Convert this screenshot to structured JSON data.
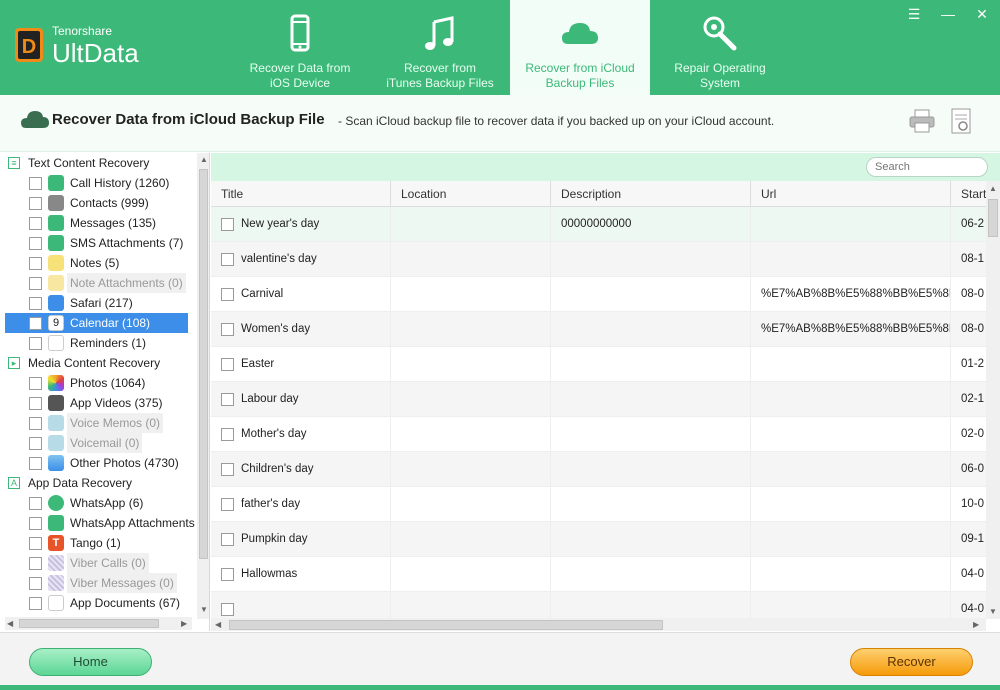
{
  "app": {
    "brand_small": "Tenorshare",
    "brand_big": "UltData",
    "accent_color": "#3cb878"
  },
  "tabs": [
    {
      "label_line1": "Recover Data from",
      "label_line2": "iOS Device",
      "icon": "phone-icon",
      "active": false
    },
    {
      "label_line1": "Recover from",
      "label_line2": "iTunes Backup Files",
      "icon": "music-note-icon",
      "active": false
    },
    {
      "label_line1": "Recover from iCloud",
      "label_line2": "Backup Files",
      "icon": "cloud-icon",
      "active": true
    },
    {
      "label_line1": "Repair Operating",
      "label_line2": "System",
      "icon": "wrench-icon",
      "active": false
    }
  ],
  "subheader": {
    "title": "Recover Data from iCloud Backup File",
    "description": "- Scan iCloud backup file to recover data if you backed up on your iCloud account."
  },
  "sidebar": {
    "categories": [
      {
        "label": "Text Content Recovery",
        "items": [
          {
            "label": "Call History (1260)",
            "icon": "phone-icon",
            "color": "#3cb878"
          },
          {
            "label": "Contacts (999)",
            "icon": "contacts-icon",
            "color": "#888888"
          },
          {
            "label": "Messages (135)",
            "icon": "message-icon",
            "color": "#3cb878"
          },
          {
            "label": "SMS Attachments (7)",
            "icon": "paperclip-icon",
            "color": "#3cb878"
          },
          {
            "label": "Notes (5)",
            "icon": "notes-icon",
            "color": "#f7e27a"
          },
          {
            "label": "Note Attachments (0)",
            "icon": "note-attachment-icon",
            "color": "#f7e7a0",
            "disabled": true
          },
          {
            "label": "Safari (217)",
            "icon": "safari-icon",
            "color": "#3c8ee8"
          },
          {
            "label": "Calendar (108)",
            "icon": "calendar-icon",
            "color": "#ffffff",
            "selected": true
          },
          {
            "label": "Reminders (1)",
            "icon": "reminders-icon",
            "color": "#ffffff"
          }
        ]
      },
      {
        "label": "Media Content Recovery",
        "items": [
          {
            "label": "Photos (1064)",
            "icon": "photos-icon",
            "color": "#f0a030"
          },
          {
            "label": "App Videos (375)",
            "icon": "video-icon",
            "color": "#555555"
          },
          {
            "label": "Voice Memos (0)",
            "icon": "microphone-icon",
            "color": "#b8dbe8",
            "disabled": true
          },
          {
            "label": "Voicemail (0)",
            "icon": "voicemail-icon",
            "color": "#b8dbe8",
            "disabled": true
          },
          {
            "label": "Other Photos (4730)",
            "icon": "landscape-icon",
            "color": "#4aa0e0"
          }
        ]
      },
      {
        "label": "App Data Recovery",
        "items": [
          {
            "label": "WhatsApp (6)",
            "icon": "whatsapp-icon",
            "color": "#3cb878"
          },
          {
            "label": "WhatsApp Attachments (",
            "icon": "paperclip-icon",
            "color": "#3cb878"
          },
          {
            "label": "Tango (1)",
            "icon": "tango-icon",
            "color": "#e8542a"
          },
          {
            "label": "Viber Calls (0)",
            "icon": "viber-calls-icon",
            "color": "#c8c0e0",
            "disabled": true
          },
          {
            "label": "Viber Messages (0)",
            "icon": "viber-messages-icon",
            "color": "#c8c0e0",
            "disabled": true
          },
          {
            "label": "App Documents (67)",
            "icon": "document-icon",
            "color": "#ffffff"
          }
        ]
      }
    ]
  },
  "search": {
    "placeholder": "Search"
  },
  "table": {
    "columns": [
      "Title",
      "Location",
      "Description",
      "Url",
      "Start"
    ],
    "rows": [
      {
        "title": "New year's day",
        "location": "",
        "description": "00000000000",
        "url": "",
        "start": "06-2"
      },
      {
        "title": "valentine's day",
        "location": "",
        "description": "",
        "url": "",
        "start": "08-1"
      },
      {
        "title": "Carnival",
        "location": "",
        "description": "",
        "url": "%E7%AB%8B%E5%88%BB%E5%8E%",
        "start": "08-0"
      },
      {
        "title": "Women's day",
        "location": "",
        "description": "",
        "url": "%E7%AB%8B%E5%88%BB%E5%8E%",
        "start": "08-0"
      },
      {
        "title": "Easter",
        "location": "",
        "description": "",
        "url": "",
        "start": "01-2"
      },
      {
        "title": "Labour day",
        "location": "",
        "description": "",
        "url": "",
        "start": "02-1"
      },
      {
        "title": "Mother's day",
        "location": "",
        "description": "",
        "url": "",
        "start": "02-0"
      },
      {
        "title": "Children's day",
        "location": "",
        "description": "",
        "url": "",
        "start": "06-0"
      },
      {
        "title": "father's day",
        "location": "",
        "description": "",
        "url": "",
        "start": "10-0"
      },
      {
        "title": "Pumpkin day",
        "location": "",
        "description": "",
        "url": "",
        "start": "09-1"
      },
      {
        "title": "Hallowmas",
        "location": "",
        "description": "",
        "url": "",
        "start": "04-0"
      },
      {
        "title": "",
        "location": "",
        "description": "",
        "url": "",
        "start": "04-0"
      }
    ]
  },
  "footer": {
    "home_label": "Home",
    "recover_label": "Recover"
  }
}
